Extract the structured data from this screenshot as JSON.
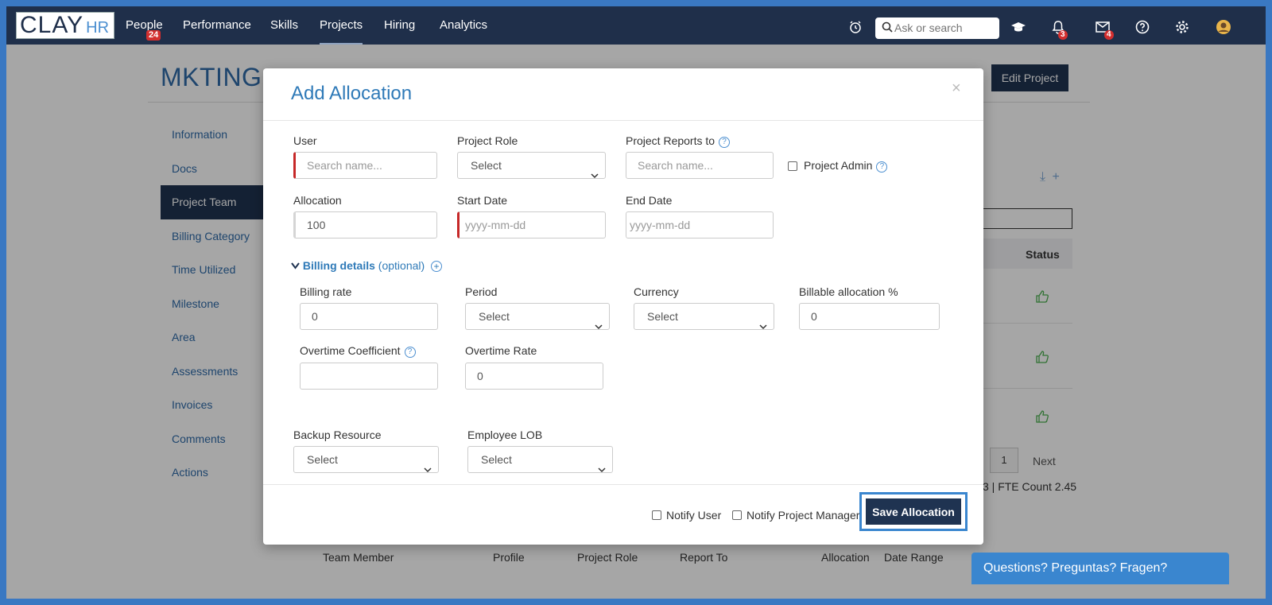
{
  "nav": {
    "logo_main": "CLAY",
    "logo_sub": "HR",
    "items": [
      {
        "label": "People",
        "badge": "24"
      },
      {
        "label": "Performance"
      },
      {
        "label": "Skills"
      },
      {
        "label": "Projects"
      },
      {
        "label": "Hiring"
      },
      {
        "label": "Analytics"
      }
    ],
    "search_placeholder": "Ask or search",
    "notifications_badge": "3",
    "messages_badge": "4"
  },
  "page": {
    "title": "MKTING",
    "edit_project_label": "Edit Project",
    "side_menu": [
      "Information",
      "Docs",
      "Project Team",
      "Billing Category",
      "Time Utilized",
      "Milestone",
      "Area",
      "Assessments",
      "Invoices",
      "Comments",
      "Actions"
    ],
    "status_header": "Status",
    "pagination_page": "1",
    "pagination_next": "Next",
    "fte_text": "3 | FTE Count 2.45",
    "table_headers": [
      "Team Member",
      "Profile",
      "Project Role",
      "Report To",
      "Allocation",
      "Date Range"
    ]
  },
  "modal": {
    "title": "Add Allocation",
    "close": "×",
    "user_label": "User",
    "user_placeholder": "Search name...",
    "project_role_label": "Project Role",
    "project_role_value": "Select",
    "reports_to_label": "Project Reports to",
    "reports_to_placeholder": "Search name...",
    "project_admin_label": "Project Admin",
    "allocation_label": "Allocation",
    "allocation_value": "100",
    "start_date_label": "Start Date",
    "start_date_placeholder": "yyyy-mm-dd",
    "end_date_label": "End Date",
    "end_date_placeholder": "yyyy-mm-dd",
    "billing_toggle": "Billing details",
    "billing_optional": "(optional)",
    "billing_rate_label": "Billing rate",
    "billing_rate_value": "0",
    "period_label": "Period",
    "period_value": "Select",
    "currency_label": "Currency",
    "currency_value": "Select",
    "billable_label": "Billable allocation %",
    "billable_value": "0",
    "overtime_coeff_label": "Overtime Coefficient",
    "overtime_rate_label": "Overtime Rate",
    "overtime_rate_value": "0",
    "backup_label": "Backup Resource",
    "backup_value": "Select",
    "lob_label": "Employee LOB",
    "lob_value": "Select",
    "notify_user_label": "Notify User",
    "notify_pm_label": "Notify Project Manager",
    "save_label": "Save Allocation"
  },
  "help_widget": "Questions? Preguntas? Fragen?",
  "colors": {
    "nav_bg": "#1f2f4a",
    "accent": "#2f7ab8",
    "primary_button": "#1f3351",
    "required_marker": "#c62828"
  }
}
